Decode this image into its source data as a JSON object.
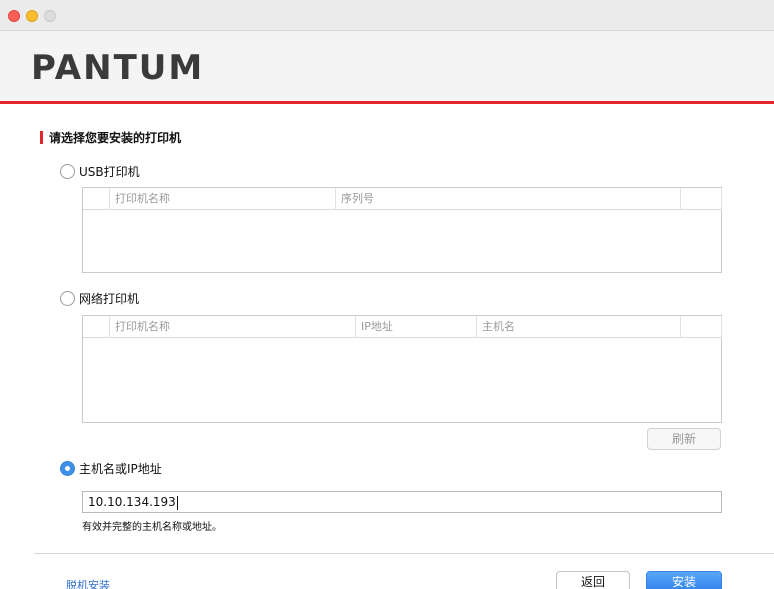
{
  "header": {
    "logo": "PANTUM"
  },
  "section_title": "请选择您要安装的打印机",
  "usb": {
    "label": "USB打印机",
    "selected": false,
    "columns": [
      "打印机名称",
      "序列号"
    ],
    "rows": []
  },
  "network": {
    "label": "网络打印机",
    "selected": false,
    "columns": [
      "打印机名称",
      "IP地址",
      "主机名"
    ],
    "rows": [],
    "refresh_label": "刷新"
  },
  "host": {
    "label": "主机名或IP地址",
    "selected": true,
    "value": "10.10.134.193",
    "hint": "有效并完整的主机名称或地址。"
  },
  "footer": {
    "offline_link": "脱机安装",
    "back_label": "返回",
    "install_label": "安装"
  },
  "colors": {
    "accent_red": "#e3262a",
    "primary_blue": "#2f80ec"
  },
  "icons": {
    "selected_radio": "radio-selected-icon",
    "unselected_radio": "radio-unselected-icon"
  }
}
